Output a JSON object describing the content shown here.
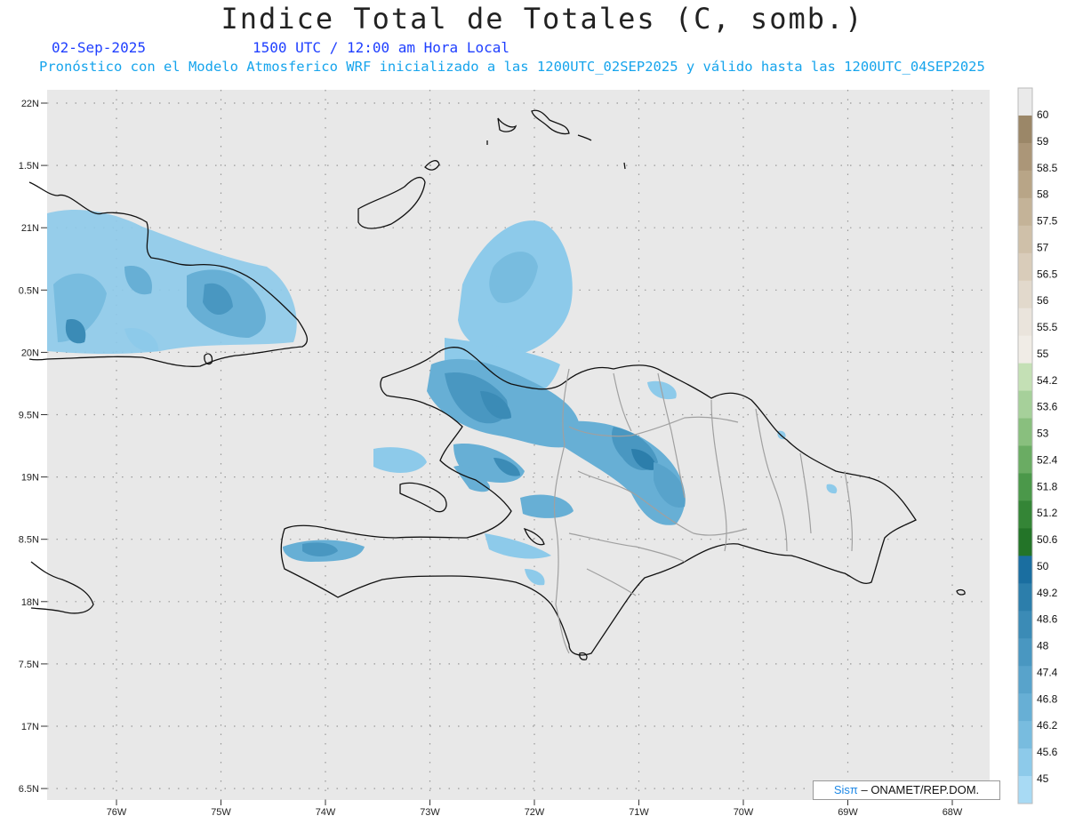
{
  "header": {
    "title": "Indice Total de Totales (C, somb.)",
    "date": "02-Sep-2025",
    "time": "1500 UTC / 12:00 am Hora Local",
    "description": "Pronóstico con el Modelo Atmosferico WRF inicializado a las 1200UTC_02SEP2025 y válido hasta las  1200UTC_04SEP2025"
  },
  "map": {
    "lat_labels": [
      "22N",
      "1.5N",
      "21N",
      "0.5N",
      "20N",
      "9.5N",
      "19N",
      "8.5N",
      "18N",
      "7.5N",
      "17N",
      "6.5N"
    ],
    "lon_labels": [
      "76W",
      "75W",
      "74W",
      "73W",
      "72W",
      "71W",
      "70W",
      "69W",
      "68W"
    ],
    "lon_values": [
      -76,
      -75,
      -74,
      -73,
      -72,
      -71,
      -70,
      -69,
      -68
    ],
    "lat_values": [
      22,
      21.5,
      21,
      20.5,
      20,
      19.5,
      19,
      18.5,
      18,
      17.5,
      17,
      16.5
    ]
  },
  "colorbar": {
    "labels": [
      "60",
      "59",
      "58.5",
      "58",
      "57.5",
      "57",
      "56.5",
      "56",
      "55.5",
      "55",
      "54.2",
      "53.6",
      "53",
      "52.4",
      "51.8",
      "51.2",
      "50.6",
      "50",
      "49.2",
      "48.6",
      "48",
      "47.4",
      "46.8",
      "46.2",
      "45.6",
      "45"
    ],
    "colors": [
      "#eaeaea",
      "#9b8768",
      "#ab9678",
      "#b8a587",
      "#c4b398",
      "#cfc0a9",
      "#d9ccba",
      "#e2d9cc",
      "#eae4dc",
      "#f0ece6",
      "#c4e0b5",
      "#a6d09a",
      "#89bf7e",
      "#6aac63",
      "#4b984a",
      "#348536",
      "#237428",
      "#1a6ea0",
      "#2c7eab",
      "#3b8bb6",
      "#4997c1",
      "#58a3cb",
      "#67afd5",
      "#78bcdf",
      "#8dcaea",
      "#a8daf4"
    ],
    "colors_desc": "top to bottom"
  },
  "credit": {
    "brand": "Sisπ",
    "text": " – ONAMET/REP.DOM."
  }
}
